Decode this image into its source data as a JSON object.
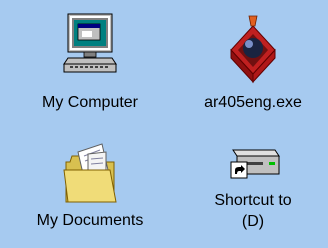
{
  "desktop": {
    "background": "#a6caf0",
    "icons": [
      {
        "label": "My Computer",
        "icon": "my-computer-icon"
      },
      {
        "label": "ar405eng.exe",
        "icon": "installer-box-icon"
      },
      {
        "label": "My Documents",
        "icon": "folder-documents-icon"
      },
      {
        "label": "Shortcut to\n(D)",
        "label_line1": "Shortcut to",
        "label_line2": "(D)",
        "icon": "drive-shortcut-icon"
      }
    ]
  }
}
